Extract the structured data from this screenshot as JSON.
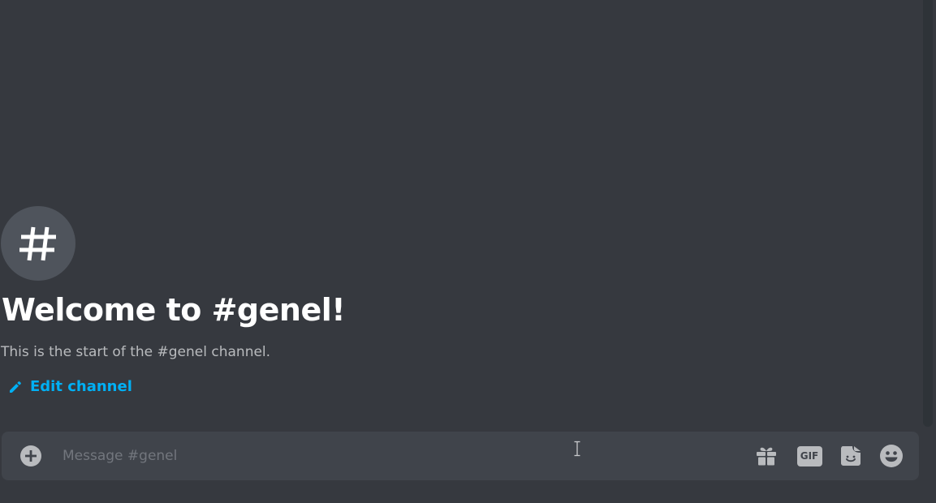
{
  "channel": {
    "welcome_title": "Welcome to #genel!",
    "welcome_subtitle": "This is the start of the #genel channel.",
    "avatar_icon": "hashtag-icon",
    "avatar_glyph": "#"
  },
  "actions": {
    "edit_channel_label": "Edit channel",
    "edit_icon": "pencil-icon"
  },
  "composer": {
    "placeholder": "Message #genel",
    "value": "",
    "attach_icon": "plus-circle-icon",
    "gift_icon": "gift-icon",
    "gif_label": "GIF",
    "sticker_icon": "sticker-icon",
    "emoji_icon": "emoji-icon"
  },
  "colors": {
    "background": "#36393f",
    "composer_bg": "#40444b",
    "link": "#00b0f4",
    "avatar_bg": "#4f545c",
    "muted_text": "#b9bbbe",
    "placeholder": "#72767d",
    "icon": "#b9bbbe"
  }
}
